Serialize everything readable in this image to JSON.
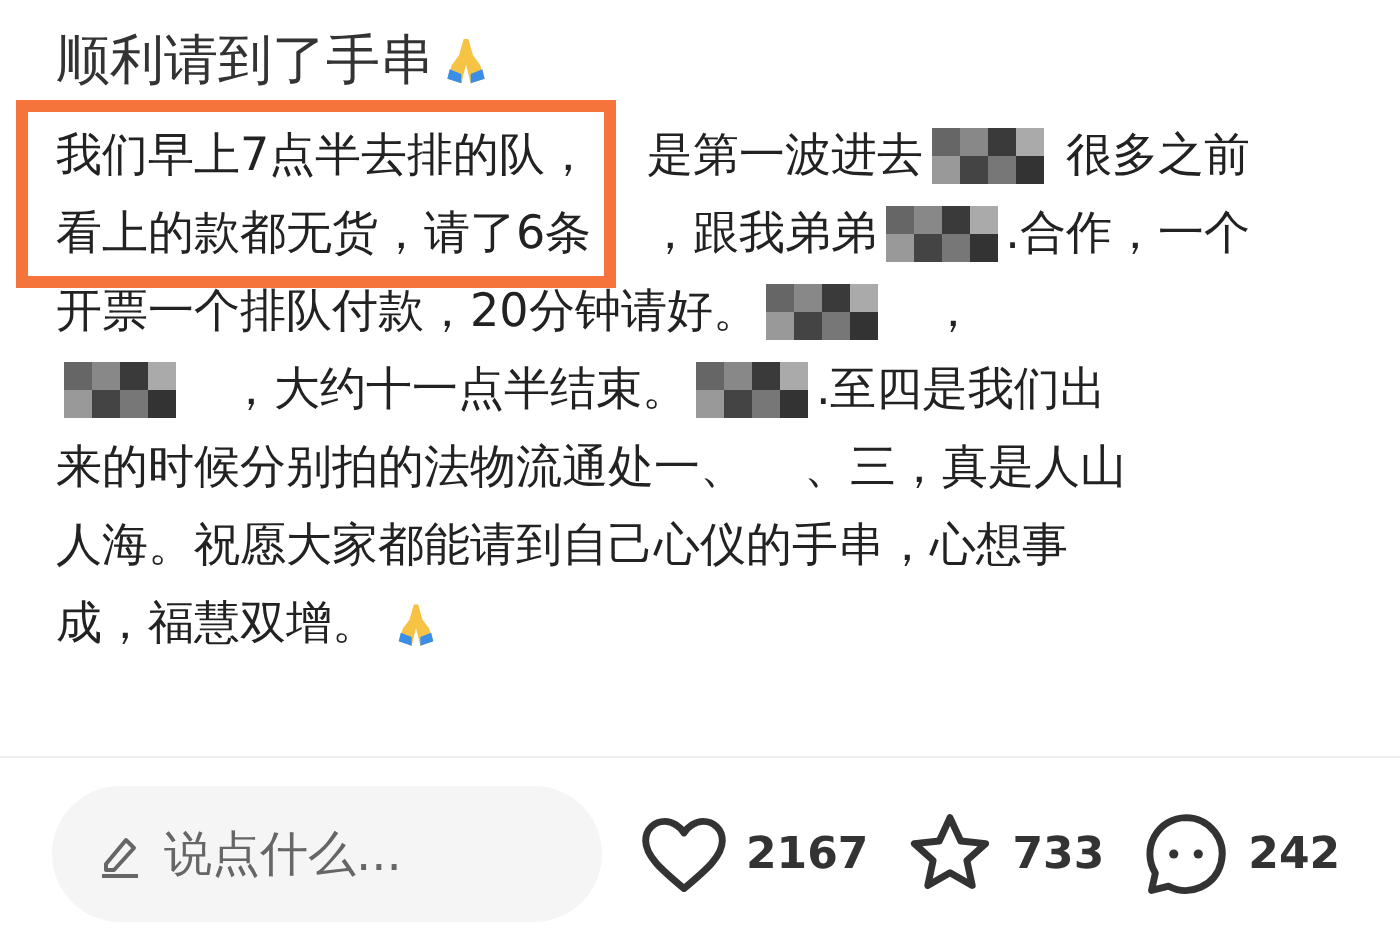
{
  "post": {
    "title": "顺利请到了手串",
    "lines": [
      [
        {
          "kind": "text",
          "text": "我们早上7点半去排的队，",
          "highlighted": true
        },
        {
          "kind": "text",
          "text": "是第一波进去"
        },
        {
          "kind": "mosaic"
        },
        {
          "kind": "text",
          "text": " 很多之前"
        }
      ],
      [
        {
          "kind": "text",
          "text": "看上的款都无货，请了6条",
          "highlighted": true
        },
        {
          "kind": "text",
          "text": "，跟我弟弟"
        },
        {
          "kind": "mosaic"
        },
        {
          "kind": "text",
          "text": ".合作，一个"
        }
      ],
      [
        {
          "kind": "text",
          "text": "开票一个排队付款，20分钟请好。"
        },
        {
          "kind": "mosaic"
        },
        {
          "kind": "text",
          "text": "   ，"
        }
      ],
      [
        {
          "kind": "mosaic"
        },
        {
          "kind": "text",
          "text": "   ，大约十一点半结束。"
        },
        {
          "kind": "mosaic"
        },
        {
          "kind": "text",
          "text": ".至四是我们出"
        }
      ],
      [
        {
          "kind": "text",
          "text": "来的时候分别拍的法物流通处一、    、三，真是人山"
        }
      ],
      [
        {
          "kind": "text",
          "text": "人海。祝愿大家都能请到自己心仪的手串，心想事"
        }
      ],
      [
        {
          "kind": "text",
          "text": "成，福慧双增。"
        },
        {
          "kind": "emoji"
        }
      ]
    ]
  },
  "comment_box": {
    "placeholder": "说点什么..."
  },
  "stats": [
    {
      "kind": "like",
      "count": "2167"
    },
    {
      "kind": "collect",
      "count": "733"
    },
    {
      "kind": "comment",
      "count": "242"
    }
  ]
}
